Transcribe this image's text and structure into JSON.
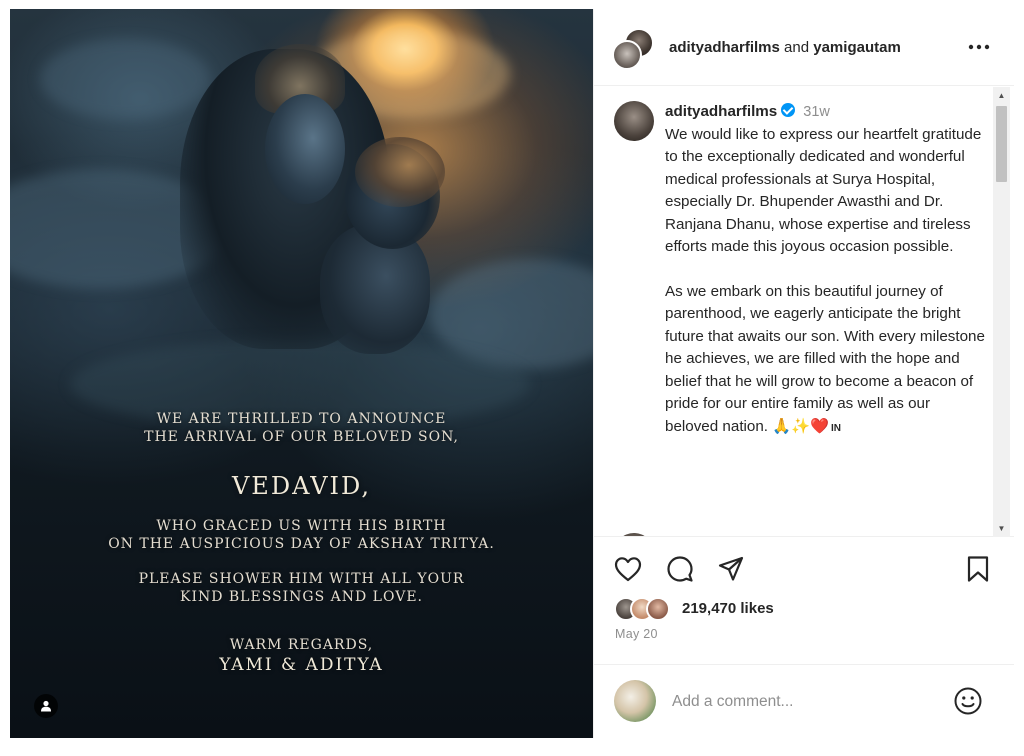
{
  "post": {
    "image_text": {
      "line1": "WE ARE THRILLED TO ANNOUNCE",
      "line2": "THE ARRIVAL OF OUR BELOVED SON,",
      "name": "VEDAVID,",
      "line3": "WHO GRACED US WITH HIS BIRTH",
      "line4": "ON THE AUSPICIOUS DAY OF AKSHAY TRITYA.",
      "line5": "PLEASE  SHOWER HIM WITH ALL YOUR",
      "line6": "KIND BLESSINGS AND LOVE.",
      "line7": "WARM REGARDS,",
      "signature": "YAMI & ADITYA"
    },
    "tag_icon": "user-icon"
  },
  "header": {
    "user1": "adityadharfilms",
    "and": "and",
    "user2": "yamigautam",
    "more_icon": "more-options-icon"
  },
  "caption": {
    "username": "adityadharfilms",
    "verified_icon": "verified-badge-icon",
    "time": "31w",
    "paragraph1": "We would like to express our heartfelt gratitude to the exceptionally dedicated and wonderful medical professionals at Surya Hospital, especially Dr. Bhupender Awasthi and Dr. Ranjana Dhanu, whose expertise and tireless efforts made this joyous occasion possible.",
    "paragraph2": "As we embark on this beautiful journey of parenthood, we eagerly anticipate the bright future that awaits our son. With every milestone he achieves, we are filled with the hope and belief that he will grow to become a beacon of pride for our entire family as well as our beloved nation. 🙏✨❤️",
    "flag_text": "IN"
  },
  "actions": {
    "like_icon": "heart-icon",
    "comment_icon": "comment-icon",
    "share_icon": "share-icon",
    "save_icon": "bookmark-icon"
  },
  "likes": {
    "count_text": "219,470 likes"
  },
  "date": "May 20",
  "comment": {
    "placeholder": "Add a comment...",
    "emoji_icon": "emoji-smile-icon"
  },
  "colors": {
    "text": "#262626",
    "muted": "#8e8e8e",
    "verified": "#0095f6",
    "border": "#dbdbdb"
  }
}
